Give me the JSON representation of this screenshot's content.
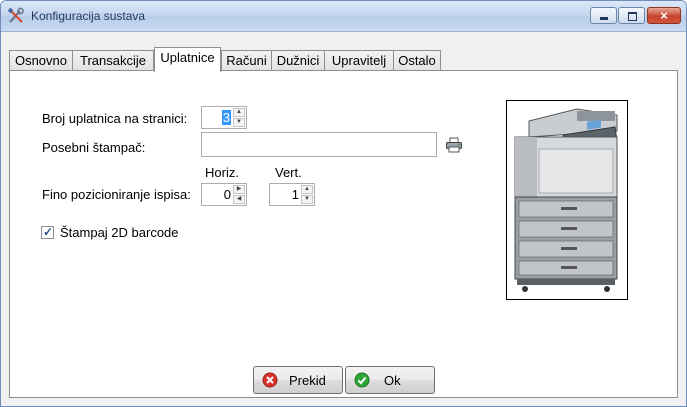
{
  "window": {
    "title": "Konfiguracija sustava",
    "controls": {
      "minimize": "minimize",
      "maximize": "maximize",
      "close": "×"
    }
  },
  "tabs": [
    {
      "label": "Osnovno"
    },
    {
      "label": "Transakcije"
    },
    {
      "label": "Uplatnice",
      "active": true
    },
    {
      "label": "Računi"
    },
    {
      "label": "Dužnici"
    },
    {
      "label": "Upravitelj"
    },
    {
      "label": "Ostalo"
    }
  ],
  "form": {
    "slips_per_page": {
      "label": "Broj uplatnica na stranici:",
      "value": "3"
    },
    "printer": {
      "label": "Posebni štampač:",
      "value": "",
      "icon": "printer-icon"
    },
    "positioning": {
      "label": "Fino pozicioniranje ispisa:",
      "horiz_label": "Horiz.",
      "vert_label": "Vert.",
      "horiz_value": "0",
      "vert_value": "1"
    },
    "barcode": {
      "label": "Štampaj 2D barcode",
      "checked": true
    }
  },
  "buttons": {
    "cancel": {
      "label": "Prekid",
      "icon": "cancel-icon"
    },
    "ok": {
      "label": "Ok",
      "icon": "check-icon"
    }
  },
  "colors": {
    "title_text": "#1e395b",
    "selection": "#3399ff",
    "cancel_icon": "#d9342b",
    "ok_icon": "#2fa63a"
  }
}
